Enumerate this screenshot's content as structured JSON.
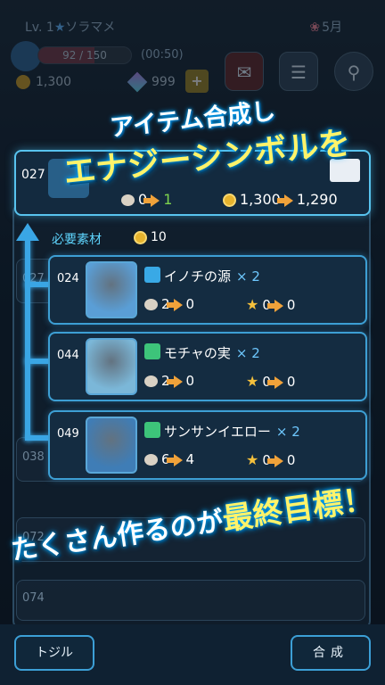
{
  "status": {
    "level": "Lv. 1",
    "player_name": "ソラマメ",
    "month": "5月",
    "energy": "92 / 150",
    "energy_fraction": 0.61,
    "timer": "(00:50)",
    "coins": "1,300",
    "gems": "999",
    "plus": "+"
  },
  "headline": {
    "line1": "アイテム合成し",
    "line2": "エナジーシンボルを",
    "line3_a": "たくさん作るのが",
    "line3_b": "最終目標！"
  },
  "target": {
    "number": "027",
    "seeds_before": "0",
    "seeds_after": "1",
    "coins_before": "1,300",
    "coins_after": "1,290"
  },
  "requirements": {
    "label": "必要素材",
    "cost": "10"
  },
  "materials": [
    {
      "number": "024",
      "name": "イノチの源",
      "qty": "× 2",
      "seeds_from": "2",
      "seeds_to": "0",
      "stars_from": "0",
      "stars_to": "0",
      "type_color": "#39a9e6",
      "thumb_color": "#5a9ed6"
    },
    {
      "number": "044",
      "name": "モチャの実",
      "qty": "× 2",
      "seeds_from": "2",
      "seeds_to": "0",
      "stars_from": "0",
      "stars_to": "0",
      "type_color": "#3dc47a",
      "thumb_color": "#7bb7d8"
    },
    {
      "number": "049",
      "name": "サンサンイエロー",
      "qty": "× 2",
      "seeds_from": "6",
      "seeds_to": "4",
      "stars_from": "0",
      "stars_to": "0",
      "type_color": "#3dc47a",
      "thumb_color": "#3f7db6"
    }
  ],
  "background_rows": [
    "027",
    "038",
    "072",
    "074"
  ],
  "buttons": {
    "close": "トジル",
    "synthesize": "合成"
  }
}
